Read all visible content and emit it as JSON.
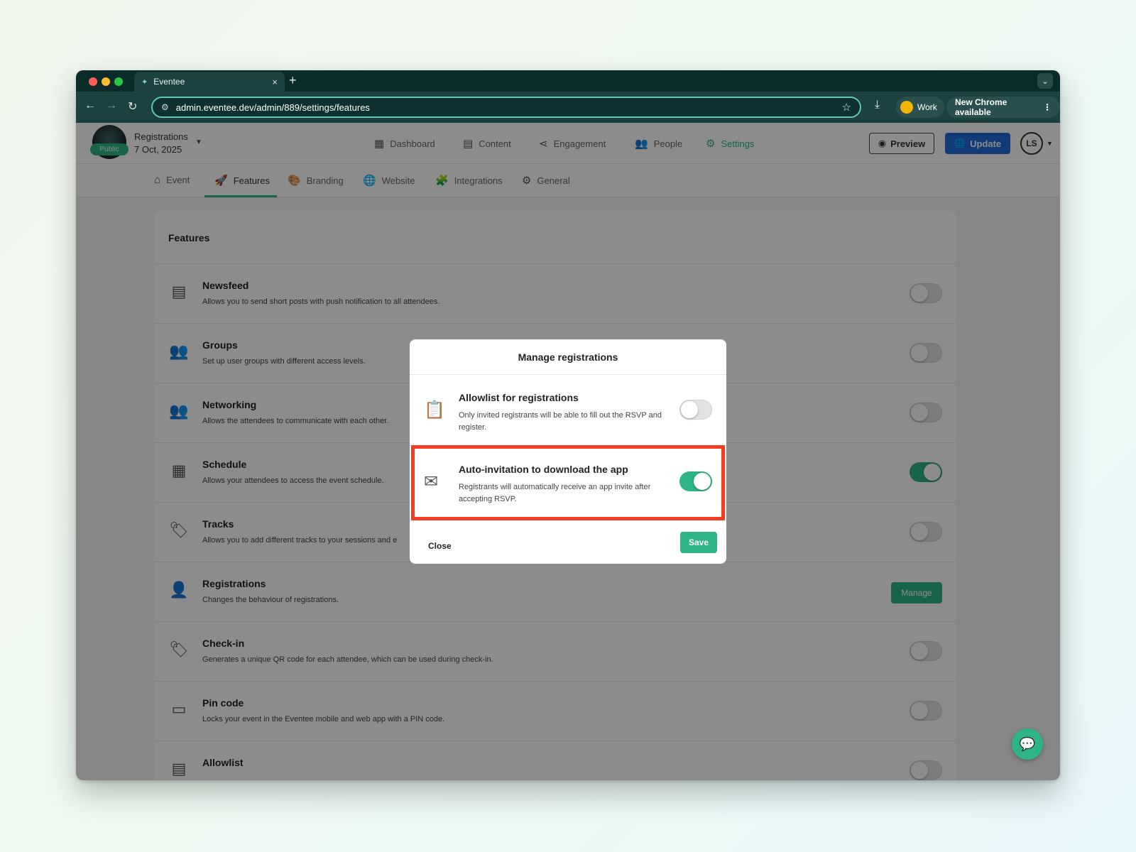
{
  "browser": {
    "tab_title": "Eventee",
    "tab_close": "×",
    "new_tab": "+",
    "tab_menu": "⌄",
    "url": "admin.eventee.dev/admin/889/settings/features",
    "profile_label": "Work",
    "update_notice": "New Chrome available",
    "kebab": "⋮",
    "icons": [
      "back-arrow-icon",
      "forward-arrow-icon",
      "reload-icon",
      "site-settings-icon",
      "star-icon",
      "download-icon"
    ]
  },
  "event": {
    "name": "Registrations",
    "date": "7 Oct, 2025",
    "status_pill": "Public"
  },
  "topnav": {
    "items": [
      {
        "label": "Dashboard",
        "icon": "grid-icon"
      },
      {
        "label": "Content",
        "icon": "calendar-icon"
      },
      {
        "label": "Engagement",
        "icon": "share-icon"
      },
      {
        "label": "People",
        "icon": "people-icon"
      },
      {
        "label": "Settings",
        "icon": "gear-icon",
        "active": true
      }
    ],
    "preview_label": "Preview",
    "update_label": "Update",
    "user_initials": "LS"
  },
  "subnav": {
    "items": [
      {
        "label": "Event",
        "icon": "home-icon"
      },
      {
        "label": "Features",
        "icon": "rocket-icon",
        "active": true
      },
      {
        "label": "Branding",
        "icon": "palette-icon"
      },
      {
        "label": "Website",
        "icon": "globe-icon"
      },
      {
        "label": "Integrations",
        "icon": "puzzle-icon"
      },
      {
        "label": "General",
        "icon": "gears-icon"
      }
    ]
  },
  "features": {
    "title": "Features",
    "manage_label": "Manage",
    "items": [
      {
        "name": "Newsfeed",
        "desc": "Allows you to send short posts with push notification to all attendees.",
        "enabled": false
      },
      {
        "name": "Groups",
        "desc": "Set up user groups with different access levels.",
        "enabled": false
      },
      {
        "name": "Networking",
        "desc": "Allows the attendees to communicate with each other.",
        "enabled": false
      },
      {
        "name": "Schedule",
        "desc": "Allows your attendees to access the event schedule.",
        "enabled": true
      },
      {
        "name": "Tracks",
        "desc": "Allows you to add different tracks to your sessions and e",
        "enabled": false
      },
      {
        "name": "Registrations",
        "desc": "Changes the behaviour of registrations."
      },
      {
        "name": "Check-in",
        "desc": "Generates a unique QR code for each attendee, which can be used during check-in.",
        "enabled": false
      },
      {
        "name": "Pin code",
        "desc": "Locks your event in the Eventee mobile and web app with a PIN code.",
        "enabled": false
      },
      {
        "name": "Allowlist",
        "desc": "",
        "enabled": false
      }
    ]
  },
  "modal": {
    "title": "Manage registrations",
    "options": [
      {
        "title": "Allowlist for registrations",
        "desc": "Only invited registrants will be able to fill out the RSVP and register.",
        "enabled": false
      },
      {
        "title": "Auto-invitation to download the app",
        "desc": "Registrants will automatically receive an app invite after accepting RSVP.",
        "enabled": true
      }
    ],
    "close_label": "Close",
    "save_label": "Save"
  },
  "colors": {
    "accent": "#2eb486",
    "update_blue": "#1f6ad8",
    "highlight": "#f23c24",
    "chrome_dark": "#0b2a2a"
  }
}
